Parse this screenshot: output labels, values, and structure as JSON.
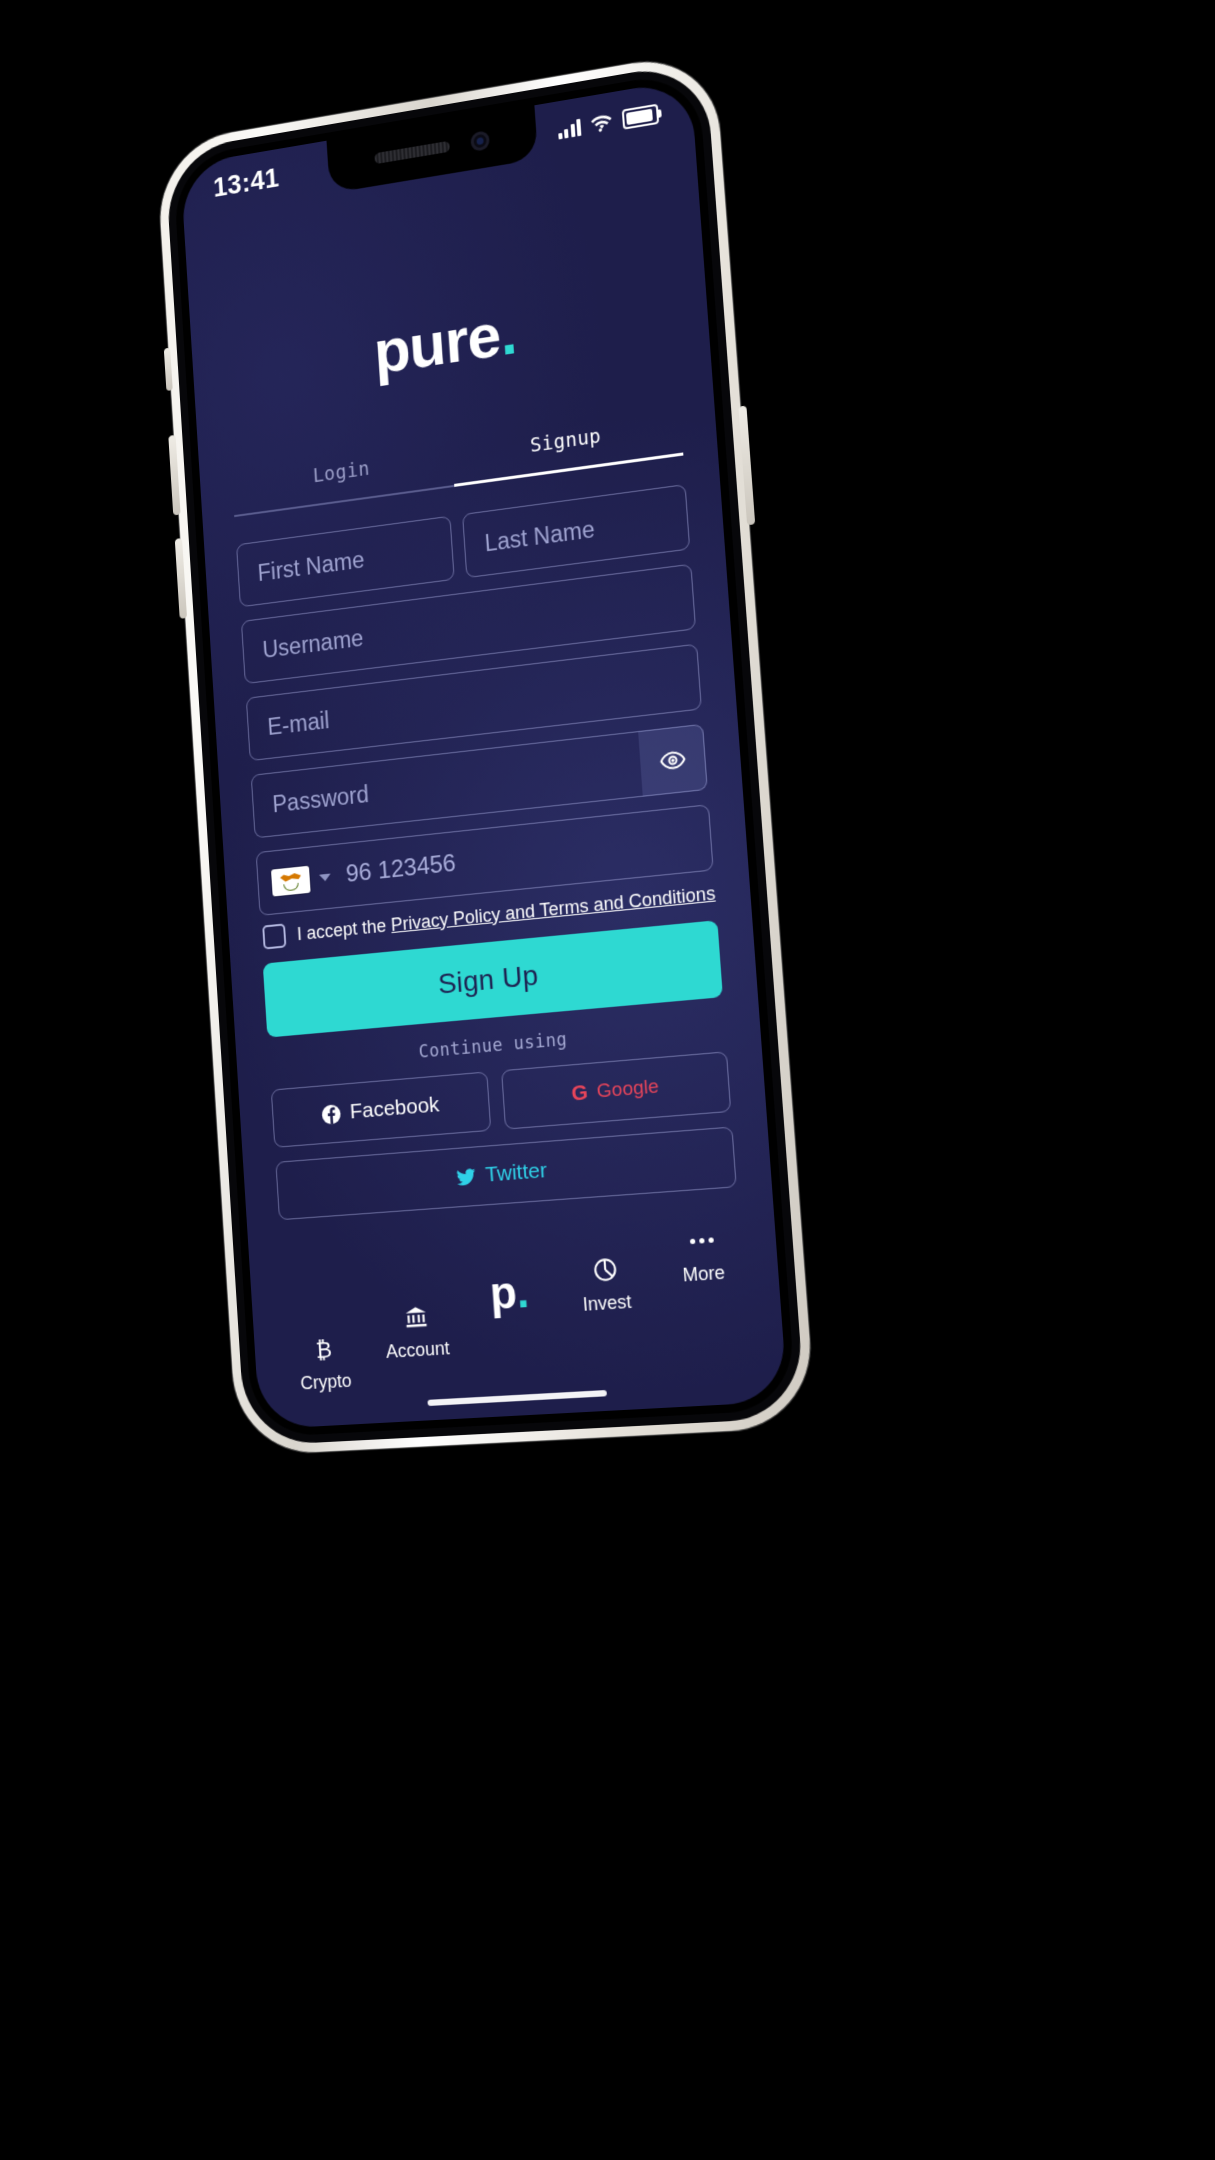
{
  "status_bar": {
    "time": "13:41",
    "signal_icon": "signal-bars-icon",
    "wifi_icon": "wifi-icon",
    "battery_icon": "battery-icon"
  },
  "brand": {
    "name": "pure",
    "dot": ".",
    "accent_color": "#2fd9d2",
    "background_color": "#1e1e4b"
  },
  "tabs": [
    {
      "label": "Login",
      "active": false
    },
    {
      "label": "Signup",
      "active": true
    }
  ],
  "form": {
    "first_name_placeholder": "First Name",
    "last_name_placeholder": "Last Name",
    "username_placeholder": "Username",
    "email_placeholder": "E-mail",
    "password_placeholder": "Password",
    "password_toggle_icon": "eye-icon",
    "country_flag": "cyprus-flag-icon",
    "country_dropdown_icon": "chevron-down-icon",
    "phone_placeholder": "96 123456",
    "accept_prefix": "I accept the ",
    "accept_link": "Privacy Policy and Terms and Conditions",
    "submit_label": "Sign Up"
  },
  "social": {
    "continue_label": "Continue using",
    "facebook": {
      "label": "Facebook",
      "icon": "facebook-icon"
    },
    "google": {
      "label": "Google",
      "icon": "google-g-icon",
      "color": "#e8455a"
    },
    "twitter": {
      "label": "Twitter",
      "icon": "twitter-bird-icon",
      "color": "#2fd1e8"
    }
  },
  "bottom_nav": [
    {
      "label": "Crypto",
      "icon": "bitcoin-icon"
    },
    {
      "label": "Account",
      "icon": "bank-icon"
    },
    {
      "label": "",
      "icon": "pure-p-logo"
    },
    {
      "label": "Invest",
      "icon": "pie-chart-icon"
    },
    {
      "label": "More",
      "icon": "ellipsis-icon"
    }
  ]
}
